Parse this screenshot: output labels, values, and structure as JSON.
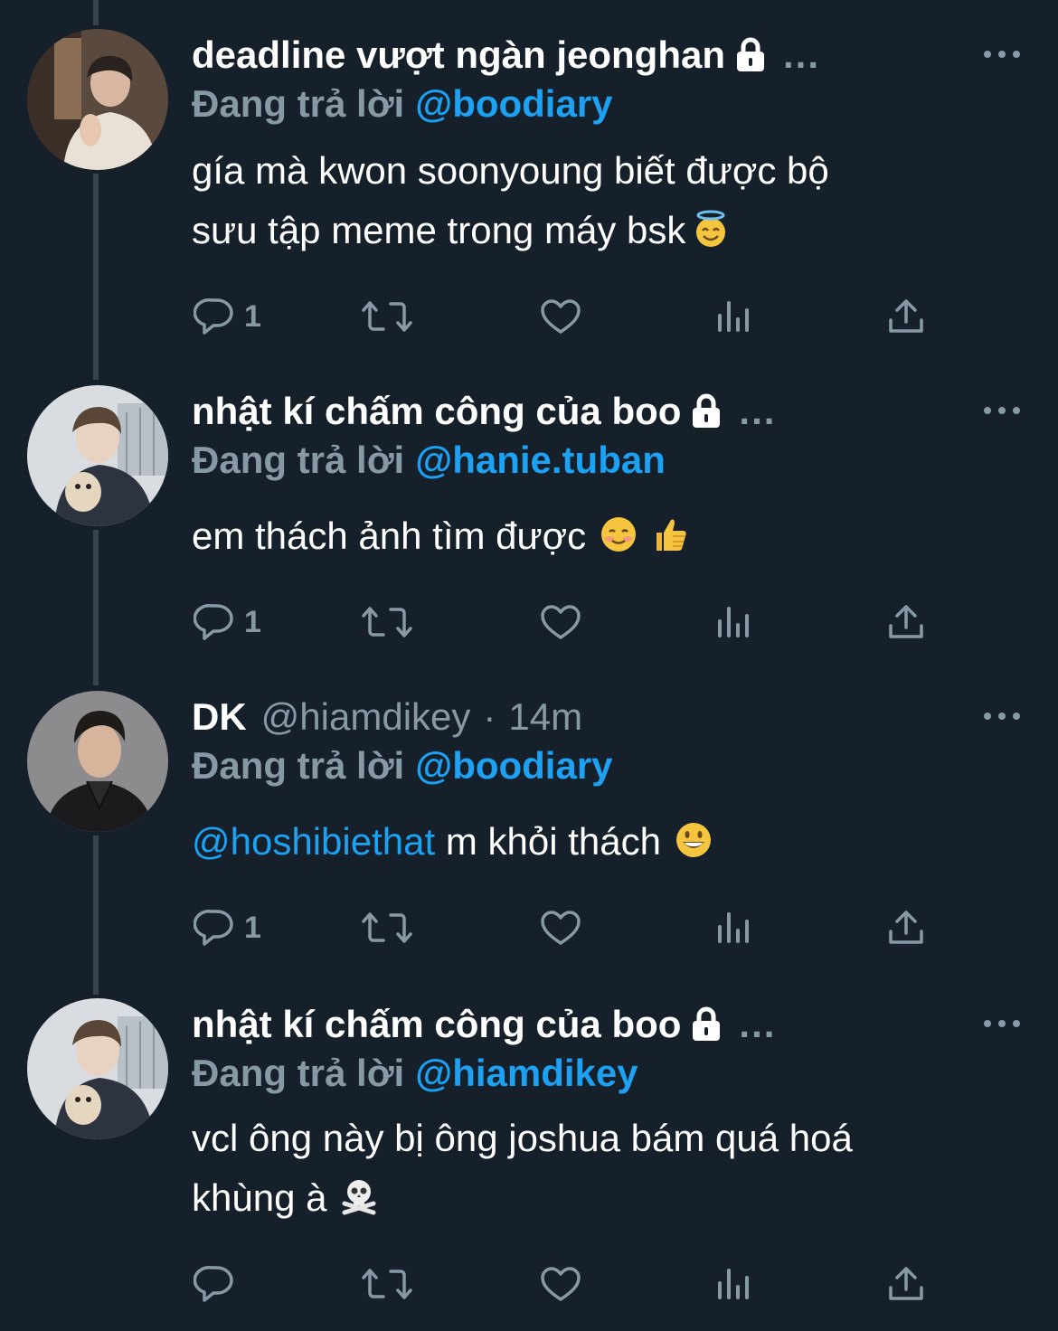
{
  "colors": {
    "background": "#15202b",
    "text_primary": "#ffffff",
    "text_secondary": "#8899a6",
    "accent": "#1da1f2",
    "thread_line": "#38444d"
  },
  "tweets": [
    {
      "display_name": "deadline vượt ngàn jeonghan",
      "protected_icon": "lock-icon",
      "name_ellipsis": "...",
      "reply_prefix": "Đang trả lời",
      "reply_target": "@boodiary",
      "body_line1": "gía mà kwon soonyoung biết được bộ",
      "body_line2": "sưu tập meme trong máy bsk",
      "body_emoji": "smiling-face-with-halo-emoji",
      "reply_count": "1"
    },
    {
      "display_name": "nhật kí chấm công của boo",
      "protected_icon": "lock-icon",
      "name_ellipsis": "...",
      "reply_prefix": "Đang trả lời",
      "reply_target": "@hanie.tuban",
      "body_line1": "em thách ảnh tìm được",
      "body_emojis": [
        "smiling-face-emoji",
        "thumbs-up-emoji"
      ],
      "reply_count": "1"
    },
    {
      "display_name": "DK",
      "handle": "@hiamdikey",
      "dot": "·",
      "time": "14m",
      "reply_prefix": "Đang trả lời",
      "reply_target": "@boodiary",
      "body_mention": "@hoshibiethat",
      "body_rest": "m khỏi thách",
      "body_emoji": "grinning-face-emoji",
      "reply_count": "1"
    },
    {
      "display_name": "nhật kí chấm công của boo",
      "protected_icon": "lock-icon",
      "name_ellipsis": "...",
      "reply_prefix": "Đang trả lời",
      "reply_target": "@hiamdikey",
      "body_line1": "vcl ông này bị ông joshua bám quá hoá",
      "body_line2": "khùng à",
      "body_emoji": "skull-and-crossbones-emoji",
      "reply_count": ""
    }
  ]
}
